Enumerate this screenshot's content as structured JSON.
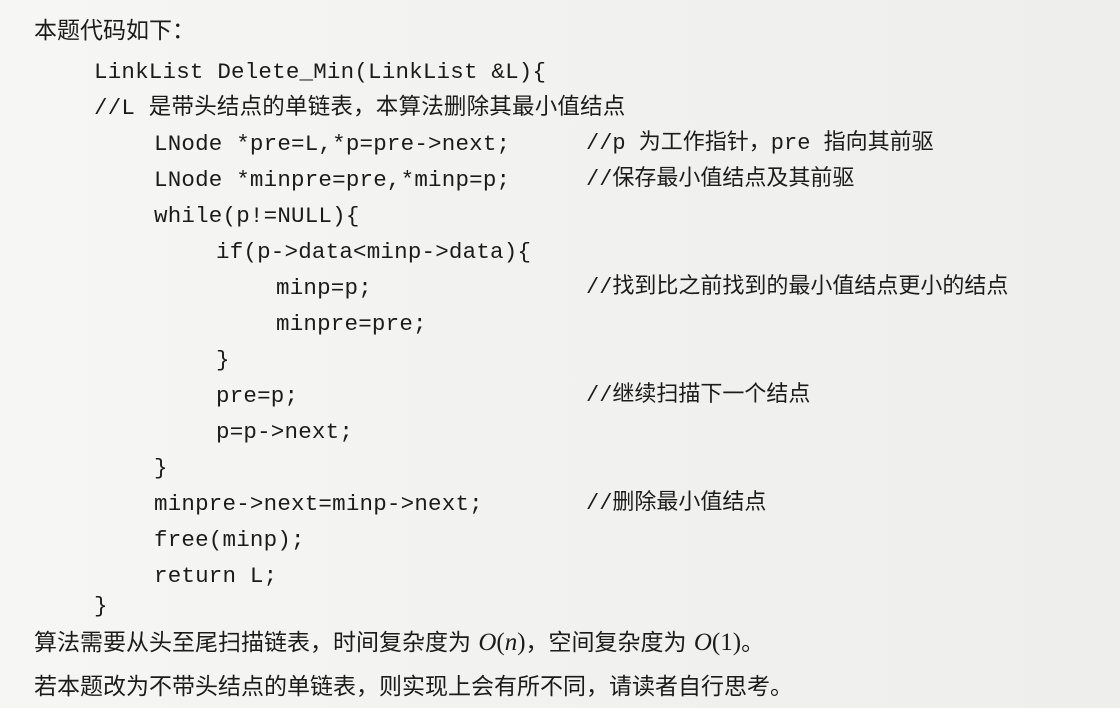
{
  "heading": "本题代码如下：",
  "code_lines": [
    {
      "code": "LinkList Delete_Min(LinkList &L){",
      "comment": ""
    },
    {
      "code": "//L 是带头结点的单链表，本算法删除其最小值结点",
      "comment": ""
    },
    {
      "code": "LNode *pre=L,*p=pre->next;",
      "comment": "//p 为工作指针，pre 指向其前驱"
    },
    {
      "code": "LNode *minpre=pre,*minp=p;",
      "comment": "//保存最小值结点及其前驱"
    },
    {
      "code": "while(p!=NULL){",
      "comment": ""
    },
    {
      "code": "if(p->data<minp->data){",
      "comment": ""
    },
    {
      "code": "minp=p;",
      "comment": "//找到比之前找到的最小值结点更小的结点"
    },
    {
      "code": "minpre=pre;",
      "comment": ""
    },
    {
      "code": "}",
      "comment": ""
    },
    {
      "code": "pre=p;",
      "comment": "//继续扫描下一个结点"
    },
    {
      "code": "p=p->next;",
      "comment": ""
    },
    {
      "code": "}",
      "comment": ""
    },
    {
      "code": "minpre->next=minp->next;",
      "comment": "//删除最小值结点"
    },
    {
      "code": "free(minp);",
      "comment": ""
    },
    {
      "code": "return  L;",
      "comment": ""
    },
    {
      "code": "}",
      "comment": ""
    }
  ],
  "para1": {
    "prefix": "算法需要从头至尾扫描链表，时间复杂度为 ",
    "o1": "O",
    "o1_arg_open": "(",
    "o1_arg": "n",
    "o1_arg_close": ")",
    "middle": "，空间复杂度为 ",
    "o2": "O",
    "o2_arg": "(1)",
    "suffix": "。"
  },
  "para2": "若本题改为不带头结点的单链表，则实现上会有所不同，请读者自行思考。"
}
